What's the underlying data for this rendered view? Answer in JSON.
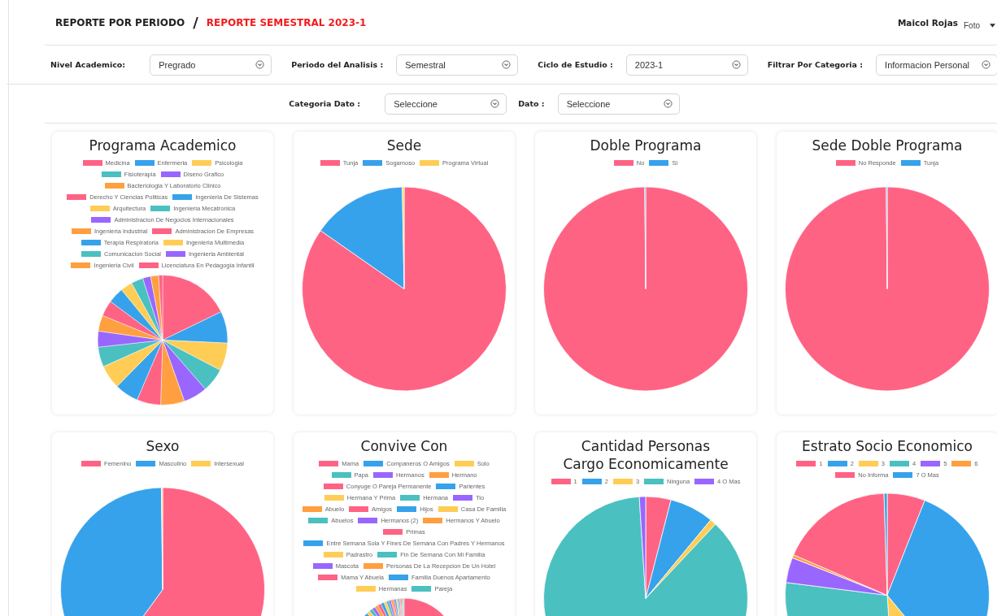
{
  "breadcrumb": {
    "section": "REPORTE POR PERIODO",
    "separator": "/",
    "current": "REPORTE SEMESTRAL 2023-1"
  },
  "user": {
    "name": "Maicol Rojas",
    "photo_alt": "Foto"
  },
  "filters": [
    {
      "label": "Nivel Academico:",
      "value": "Pregrado"
    },
    {
      "label": "Periodo del Analisis :",
      "value": "Semestral"
    },
    {
      "label": "Ciclo de Estudio :",
      "value": "2023-1"
    },
    {
      "label": "Filtrar Por Categoria :",
      "value": "Informacion Personal"
    }
  ],
  "filters_2": [
    {
      "label": "Categoria Dato :",
      "value": "Seleccione"
    },
    {
      "label": "Dato :",
      "value": "Seleccione"
    }
  ],
  "charts": [
    {
      "title": "Programa Academico",
      "legend": [
        {
          "label": "Medicina",
          "color": "#ff6384"
        },
        {
          "label": "Enfermeria",
          "color": "#36a2eb"
        },
        {
          "label": "Psicologia",
          "color": "#ffcd56"
        },
        {
          "label": "Fisioterapia",
          "color": "#4bc0c0"
        },
        {
          "label": "Diseno Grafico",
          "color": "#9966ff"
        },
        {
          "label": "Bacteriologia Y Laboratorio Clinico",
          "color": "#ff9f40"
        },
        {
          "label": "Derecho Y Ciencias Politicas",
          "color": "#ff6384"
        },
        {
          "label": "Ingenieria De Sistemas",
          "color": "#36a2eb"
        },
        {
          "label": "Arquitectura",
          "color": "#ffcd56"
        },
        {
          "label": "Ingenieria Mecatronica",
          "color": "#4bc0c0"
        },
        {
          "label": "Administracion De Negocios Internacionales",
          "color": "#9966ff"
        },
        {
          "label": "Ingenieria Industrial",
          "color": "#ff9f40"
        },
        {
          "label": "Administracion De Empresas",
          "color": "#ff6384"
        },
        {
          "label": "Terapia Respiratoria",
          "color": "#36a2eb"
        },
        {
          "label": "Ingenieria Multimedia",
          "color": "#ffcd56"
        },
        {
          "label": "Comunicacion Social",
          "color": "#4bc0c0"
        },
        {
          "label": "Ingenieria Ambiental",
          "color": "#9966ff"
        },
        {
          "label": "Ingenieria Civil",
          "color": "#ff9f40"
        },
        {
          "label": "Licenciatura En Pedagogia Infantil",
          "color": "#ff6384"
        }
      ]
    },
    {
      "title": "Sede",
      "legend": [
        {
          "label": "Tunja",
          "color": "#ff6384"
        },
        {
          "label": "Sogamoso",
          "color": "#36a2eb"
        },
        {
          "label": "Programa Virtual",
          "color": "#ffcd56"
        }
      ]
    },
    {
      "title": "Doble Programa",
      "legend": [
        {
          "label": "No",
          "color": "#ff6384"
        },
        {
          "label": "Si",
          "color": "#36a2eb"
        }
      ]
    },
    {
      "title": "Sede Doble Programa",
      "legend": [
        {
          "label": "No Responde",
          "color": "#ff6384"
        },
        {
          "label": "Tunja",
          "color": "#36a2eb"
        }
      ]
    },
    {
      "title": "Sexo",
      "legend": [
        {
          "label": "Femenino",
          "color": "#ff6384"
        },
        {
          "label": "Masculino",
          "color": "#36a2eb"
        },
        {
          "label": "Intersexual",
          "color": "#ffcd56"
        }
      ]
    },
    {
      "title": "Convive Con",
      "legend": [
        {
          "label": "Mama",
          "color": "#ff6384"
        },
        {
          "label": "Companeros O Amigos",
          "color": "#36a2eb"
        },
        {
          "label": "Solo",
          "color": "#ffcd56"
        },
        {
          "label": "Papa",
          "color": "#4bc0c0"
        },
        {
          "label": "Hermanos",
          "color": "#9966ff"
        },
        {
          "label": "Hermano",
          "color": "#ff9f40"
        },
        {
          "label": "Conyuge O Pareja Permanente",
          "color": "#ff6384"
        },
        {
          "label": "Parientes",
          "color": "#36a2eb"
        },
        {
          "label": "Hermana Y Prima",
          "color": "#ffcd56"
        },
        {
          "label": "Hermana",
          "color": "#4bc0c0"
        },
        {
          "label": "Tio",
          "color": "#9966ff"
        },
        {
          "label": "Abuelo",
          "color": "#ff9f40"
        },
        {
          "label": "Amigos",
          "color": "#ff6384"
        },
        {
          "label": "Hijos",
          "color": "#36a2eb"
        },
        {
          "label": "Casa De Familia",
          "color": "#ffcd56"
        },
        {
          "label": "Abuelos",
          "color": "#4bc0c0"
        },
        {
          "label": "Hermanos (2)",
          "color": "#9966ff"
        },
        {
          "label": "Hermanos Y Abuelo",
          "color": "#ff9f40"
        },
        {
          "label": "Primas",
          "color": "#ff6384"
        },
        {
          "label": "Entre Semana Sola Y Fines De Semana Con Padres Y Hermanos",
          "color": "#36a2eb"
        },
        {
          "label": "Padrastro",
          "color": "#ffcd56"
        },
        {
          "label": "Fin De Semana Con Mi Familia",
          "color": "#4bc0c0"
        },
        {
          "label": "Mascota",
          "color": "#9966ff"
        },
        {
          "label": "Personas De La Recepcion De Un Hotel",
          "color": "#ff9f40"
        },
        {
          "label": "Mama Y Abuela",
          "color": "#ff6384"
        },
        {
          "label": "Familia Duenos Apartamento",
          "color": "#36a2eb"
        },
        {
          "label": "Hermanas",
          "color": "#ffcd56"
        },
        {
          "label": "Pareja",
          "color": "#4bc0c0"
        }
      ]
    },
    {
      "title": [
        "Cantidad Personas",
        "Cargo Economicamente"
      ],
      "legend": [
        {
          "label": "1",
          "color": "#ff6384"
        },
        {
          "label": "2",
          "color": "#36a2eb"
        },
        {
          "label": "3",
          "color": "#ffcd56"
        },
        {
          "label": "Ninguna",
          "color": "#4bc0c0"
        },
        {
          "label": "4 O Mas",
          "color": "#9966ff"
        }
      ]
    },
    {
      "title": "Estrato Socio Economico",
      "legend": [
        {
          "label": "1",
          "color": "#ff6384"
        },
        {
          "label": "2",
          "color": "#36a2eb"
        },
        {
          "label": "3",
          "color": "#ffcd56"
        },
        {
          "label": "4",
          "color": "#4bc0c0"
        },
        {
          "label": "5",
          "color": "#9966ff"
        },
        {
          "label": "6",
          "color": "#ff9f40"
        },
        {
          "label": "No Informa",
          "color": "#ff6384"
        },
        {
          "label": "7 O Mas",
          "color": "#36a2eb"
        }
      ]
    }
  ]
}
